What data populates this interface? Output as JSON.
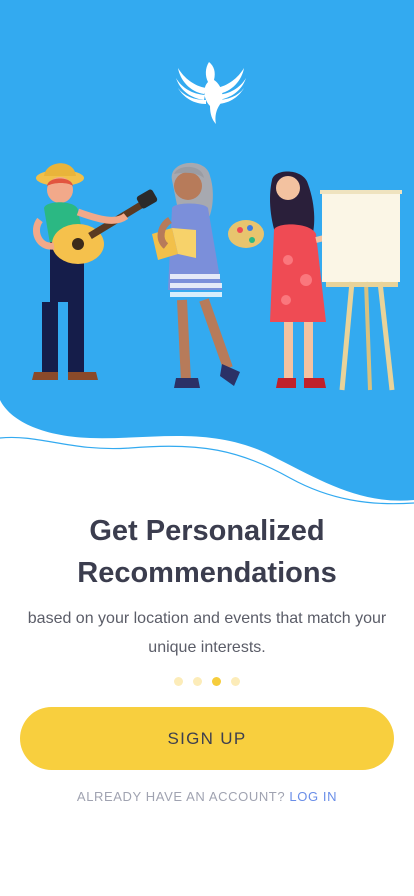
{
  "onboarding": {
    "title_line1": "Get Personalized",
    "title_line2": "Recommendations",
    "subtitle_line1": "based on your location and events that match your",
    "subtitle_line2": "unique interests.",
    "pagination": {
      "total": 4,
      "active_index": 2
    }
  },
  "actions": {
    "signup_label": "SIGN UP",
    "login_prompt": "ALREADY HAVE AN ACCOUNT?",
    "login_label": "LOG IN"
  },
  "icons": {
    "logo": "dove-icon",
    "illustration": "people-hobbies-illustration"
  },
  "colors": {
    "hero_blue": "#33aaf0",
    "accent_yellow": "#f8cf3e",
    "dot_inactive": "#fcecb9",
    "title_text": "#3b3d4e",
    "link_blue": "#6a8ee8"
  }
}
